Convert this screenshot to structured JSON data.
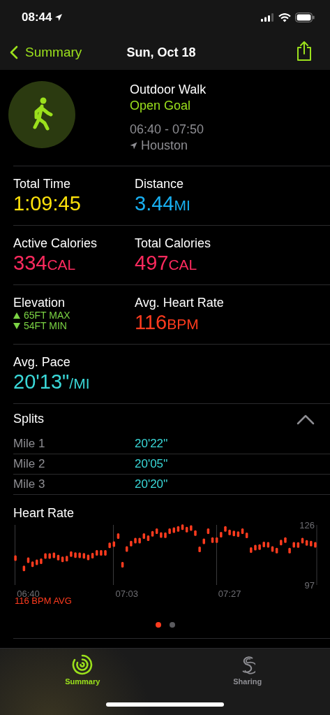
{
  "status_bar": {
    "time": "08:44"
  },
  "nav": {
    "back": "Summary",
    "title": "Sun, Oct 18"
  },
  "workout": {
    "name": "Outdoor Walk",
    "goal": "Open Goal",
    "time_range": "06:40 - 07:50",
    "location": "Houston"
  },
  "metric_rows": [
    {
      "items": [
        {
          "kind": "value",
          "label": "Total Time",
          "value": "1:09:45",
          "color": "#ffe20a"
        },
        {
          "kind": "value",
          "label": "Distance",
          "value": "3.44",
          "unit": "MI",
          "color": "#18b0f2"
        }
      ]
    },
    {
      "items": [
        {
          "kind": "value",
          "label": "Active Calories",
          "value": "334",
          "unit": "CAL",
          "color": "#fe2a5e"
        },
        {
          "kind": "value",
          "label": "Total Calories",
          "value": "497",
          "unit": "CAL",
          "color": "#fe2a5e"
        }
      ]
    },
    {
      "items": [
        {
          "kind": "range",
          "label": "Elevation",
          "color": "#7cd444",
          "lines": [
            {
              "kind": "max",
              "text": "65FT MAX"
            },
            {
              "kind": "min",
              "text": "54FT MIN"
            }
          ]
        },
        {
          "kind": "value",
          "label": "Avg. Heart Rate",
          "value": "116",
          "unit": "BPM",
          "color": "#ff3b1e"
        }
      ]
    },
    {
      "items": [
        {
          "kind": "value",
          "label": "Avg. Pace",
          "value": "20'13\"",
          "unit": "/MI",
          "color": "#3ad8d8"
        }
      ]
    }
  ],
  "splits": {
    "title": "Splits",
    "expanded": true,
    "rows": [
      {
        "label": "Mile 1",
        "pace": "20'22''"
      },
      {
        "label": "Mile 2",
        "pace": "20'05''"
      },
      {
        "label": "Mile 3",
        "pace": "20'20''"
      }
    ]
  },
  "heart_rate": {
    "title": "Heart Rate",
    "chart_data": {
      "type": "scatter",
      "categories": [
        null,
        null,
        null,
        "06:40",
        null,
        null,
        null,
        null,
        null,
        null,
        null,
        null,
        null,
        null,
        null,
        null,
        null,
        null,
        null,
        null,
        null,
        null,
        null,
        null,
        null,
        null,
        "07:03",
        null,
        null,
        null,
        null,
        null,
        null,
        null,
        null,
        null,
        null,
        null,
        null,
        null,
        null,
        null,
        null,
        null,
        null,
        null,
        null,
        null,
        null,
        null,
        "07:27",
        null,
        null,
        null,
        null,
        null,
        null,
        null,
        null,
        null,
        null,
        null,
        null,
        null,
        null,
        null,
        null,
        null,
        null,
        null,
        null
      ],
      "series": [
        {
          "color": "#ff3b1e",
          "values": [
            110,
            null,
            105,
            109,
            107,
            108,
            108.5,
            111,
            111,
            111.3,
            110.2,
            109.4,
            109.7,
            111.9,
            111.4,
            111.3,
            111.1,
            110.3,
            111.2,
            112.5,
            112.5,
            112.5,
            116.1,
            116.7,
            120.6,
            106.8,
            114.4,
            117,
            118.4,
            118.4,
            120.6,
            119.6,
            121.7,
            123,
            121.1,
            121,
            123,
            123.5,
            124.1,
            124.9,
            123.7,
            124.5,
            122,
            114.2,
            118.1,
            123,
            118.7,
            118.7,
            121.3,
            124.1,
            122.4,
            121.9,
            121.5,
            123,
            120.9,
            113.9,
            115,
            115.3,
            116.6,
            116.4,
            114.4,
            113.6,
            117.5,
            118.7,
            113.6,
            116.4,
            116.3,
            118.4,
            117.3,
            117,
            116.4
          ]
        }
      ],
      "ylim": [
        97,
        126
      ],
      "yticks": [
        97,
        126
      ]
    },
    "average": "116 BPM AVG"
  },
  "pager": [
    {
      "selected": true
    },
    {
      "selected": false
    }
  ],
  "tabs": [
    {
      "kind": "rings",
      "label": "Summary",
      "selected": true
    },
    {
      "kind": "sharing",
      "label": "Sharing",
      "selected": false
    }
  ]
}
